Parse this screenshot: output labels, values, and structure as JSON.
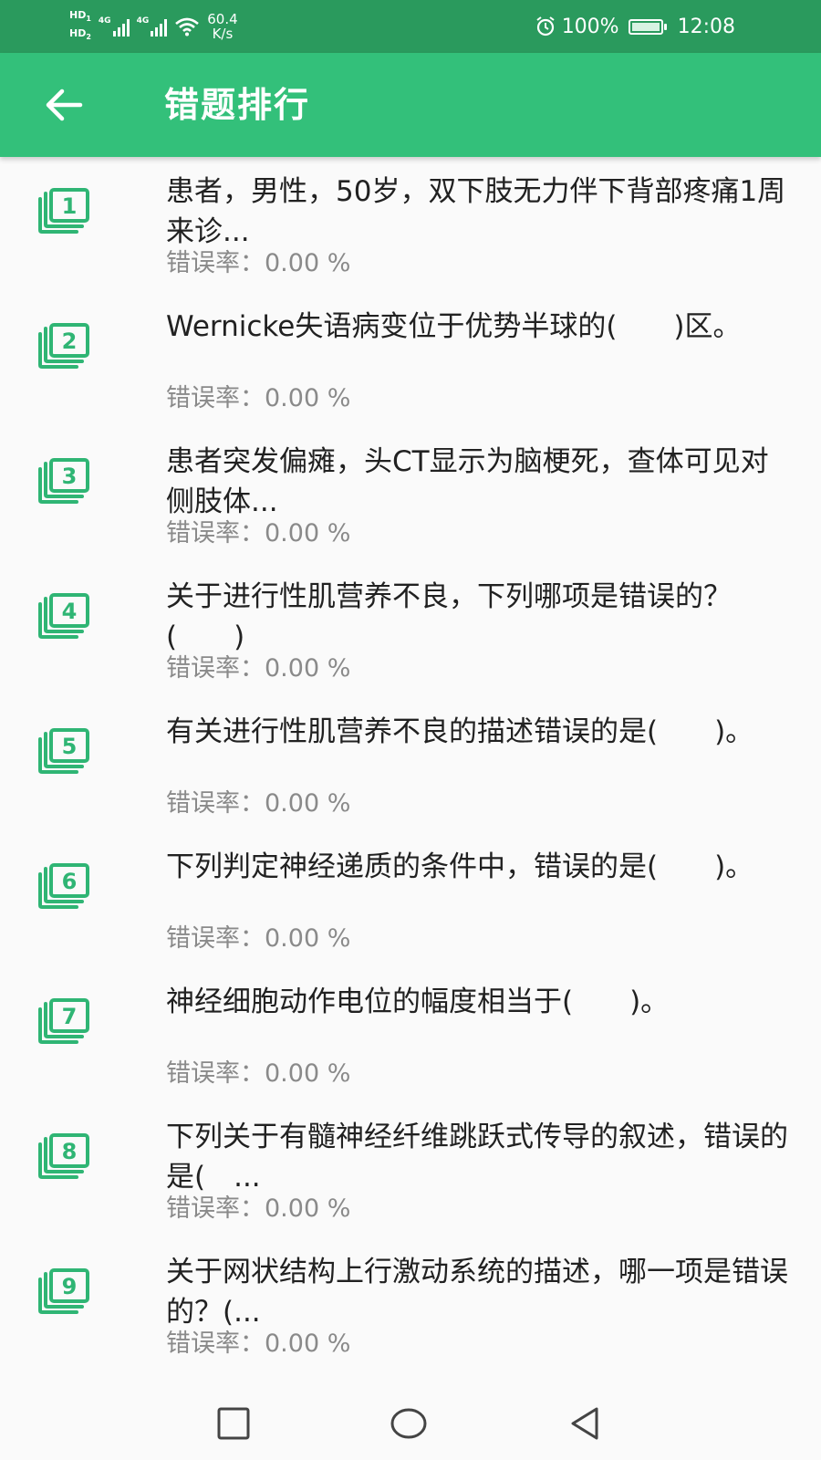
{
  "status_bar": {
    "hd1": "HD",
    "hd1_sub": "1",
    "hd2": "HD",
    "hd2_sub": "2",
    "signal1_label": "4G",
    "signal2_label": "4G",
    "speed_value": "60.4",
    "speed_unit": "K/s",
    "battery": "100%",
    "time": "12:08",
    "icons": [
      "signal-icon",
      "wifi-icon",
      "alarm-icon",
      "battery-charging-icon"
    ]
  },
  "app_bar": {
    "title": "错题排行",
    "back_icon": "arrow-back-icon",
    "color": "#33c07a"
  },
  "items": [
    {
      "rank": "1",
      "title": "患者，男性，50岁，双下肢无力伴下背部疼痛1周来诊...",
      "rate": "错误率：0.00 %"
    },
    {
      "rank": "2",
      "title": "Wernicke失语病变位于优势半球的(　　)区。",
      "rate": "错误率：0.00 %"
    },
    {
      "rank": "3",
      "title": "患者突发偏瘫，头CT显示为脑梗死，查体可见对侧肢体...",
      "rate": "错误率：0.00 %"
    },
    {
      "rank": "4",
      "title": "关于进行性肌营养不良，下列哪项是错误的？(　　)",
      "rate": "错误率：0.00 %"
    },
    {
      "rank": "5",
      "title": "有关进行性肌营养不良的描述错误的是(　　)。",
      "rate": "错误率：0.00 %"
    },
    {
      "rank": "6",
      "title": "下列判定神经递质的条件中，错误的是(　　)。",
      "rate": "错误率：0.00 %"
    },
    {
      "rank": "7",
      "title": "神经细胞动作电位的幅度相当于(　　)。",
      "rate": "错误率：0.00 %"
    },
    {
      "rank": "8",
      "title": "下列关于有髓神经纤维跳跃式传导的叙述，错误的是(　...",
      "rate": "错误率：0.00 %"
    },
    {
      "rank": "9",
      "title": "关于网状结构上行激动系统的描述，哪一项是错误的？(...",
      "rate": "错误率：0.00 %"
    }
  ],
  "icon_color": "#2fb574",
  "nav_bar": {
    "icons": [
      "recent-apps-icon",
      "home-icon",
      "back-icon"
    ]
  }
}
